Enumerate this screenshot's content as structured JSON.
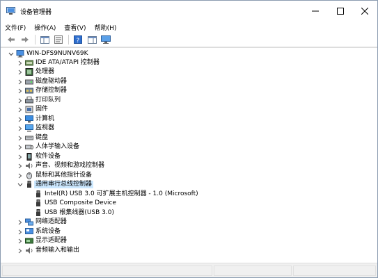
{
  "window": {
    "title": "设备管理器"
  },
  "menu": [
    "文件(F)",
    "操作(A)",
    "查看(V)",
    "帮助(H)"
  ],
  "toolbar": [
    {
      "icon": "back-arrow-icon"
    },
    {
      "icon": "forward-arrow-icon"
    },
    {
      "icon": "show-hide-tree-icon"
    },
    {
      "icon": "properties-icon"
    },
    {
      "icon": "help-icon"
    },
    {
      "icon": "view-panel-icon"
    },
    {
      "icon": "monitor-icon"
    }
  ],
  "tree": {
    "root": "WIN-DFS9NUNV69K",
    "categories": [
      {
        "label": "IDE ATA/ATAPI 控制器",
        "icon": "ide-controller-icon",
        "expanded": false
      },
      {
        "label": "处理器",
        "icon": "processor-icon",
        "expanded": false
      },
      {
        "label": "磁盘驱动器",
        "icon": "disk-drive-icon",
        "expanded": false
      },
      {
        "label": "存储控制器",
        "icon": "storage-controller-icon",
        "expanded": false
      },
      {
        "label": "打印队列",
        "icon": "printer-icon",
        "expanded": false
      },
      {
        "label": "固件",
        "icon": "firmware-icon",
        "expanded": false
      },
      {
        "label": "计算机",
        "icon": "computer-icon",
        "expanded": false
      },
      {
        "label": "监视器",
        "icon": "monitor-icon",
        "expanded": false
      },
      {
        "label": "键盘",
        "icon": "keyboard-icon",
        "expanded": false
      },
      {
        "label": "人体学输入设备",
        "icon": "hid-icon",
        "expanded": false
      },
      {
        "label": "软件设备",
        "icon": "software-device-icon",
        "expanded": false
      },
      {
        "label": "声音、视频和游戏控制器",
        "icon": "audio-icon",
        "expanded": false
      },
      {
        "label": "鼠标和其他指针设备",
        "icon": "mouse-icon",
        "expanded": false
      },
      {
        "label": "通用串行总线控制器",
        "icon": "usb-icon",
        "expanded": true,
        "selected": true,
        "children": [
          "Intel(R) USB 3.0 可扩展主机控制器 - 1.0 (Microsoft)",
          "USB Composite Device",
          "USB 根集线器(USB 3.0)"
        ]
      },
      {
        "label": "网络适配器",
        "icon": "network-adapter-icon",
        "expanded": false
      },
      {
        "label": "系统设备",
        "icon": "system-device-icon",
        "expanded": false
      },
      {
        "label": "显示适配器",
        "icon": "display-adapter-icon",
        "expanded": false
      },
      {
        "label": "音频输入和输出",
        "icon": "audio-io-icon",
        "expanded": false
      }
    ]
  },
  "colors": {
    "selection": "#cce8ff",
    "folder_blue": "#3a7bd5"
  }
}
